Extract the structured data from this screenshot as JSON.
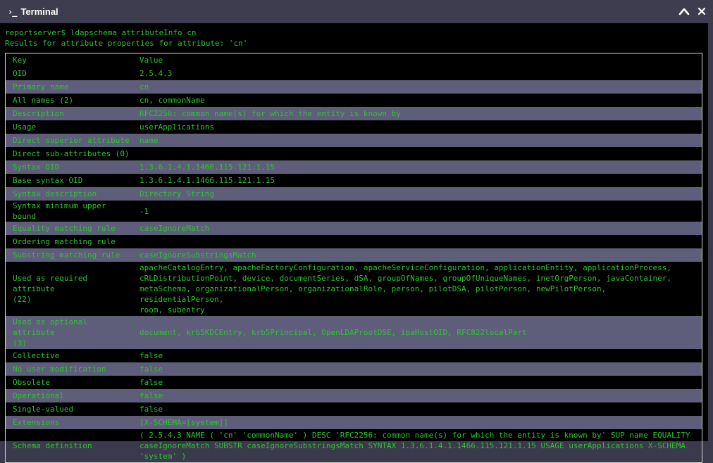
{
  "window": {
    "title": "Terminal",
    "icon": "terminal-icon",
    "prompt_glyph": "›_"
  },
  "terminal": {
    "command_line": "reportserver$ ldapschema attributeInfo cn",
    "result_line": "Results for attribute properties for attribute: 'cn'",
    "table": {
      "header": {
        "key": "Key",
        "value": "Value"
      },
      "rows": [
        {
          "key": "OID",
          "value": "2.5.4.3"
        },
        {
          "key": "Primary name",
          "value": "cn"
        },
        {
          "key": "All names (2)",
          "value": "cn, commonName"
        },
        {
          "key": "Description",
          "value": "RFC2256: common name(s) for which the entity is known by"
        },
        {
          "key": "Usage",
          "value": "userApplications"
        },
        {
          "key": "Direct superior attribute",
          "value": "name"
        },
        {
          "key": "Direct sub-attributes (0)",
          "value": ""
        },
        {
          "key": "Syntax OID",
          "value": "1.3.6.1.4.1.1466.115.121.1.15"
        },
        {
          "key": "Base syntax OID",
          "value": "1.3.6.1.4.1.1466.115.121.1.15"
        },
        {
          "key": "Syntax description",
          "value": "Directory String"
        },
        {
          "key": "Syntax minimum upper bound",
          "value": "-1"
        },
        {
          "key": "Equality matching rule",
          "value": "caseIgnoreMatch"
        },
        {
          "key": "Ordering matching rule",
          "value": ""
        },
        {
          "key": "Substring matching rule",
          "value": "caseIgnoreSubstringsMatch"
        },
        {
          "key": "Used as required attribute\n(22)",
          "value": "apacheCatalogEntry, apacheFactoryConfiguration, apacheServiceConfiguration, applicationEntity, applicationProcess,\ncRLDistributionPoint, device, documentSeries, dSA, groupOfNames, groupOfUniqueNames, inetOrgPerson, javaContainer,\nmetaSchema, organizationalPerson, organizationalRole, person, pilotDSA, pilotPerson, newPilotPerson, residentialPerson,\nroom, subentry"
        },
        {
          "key": "Used as optional attribute\n(3)",
          "value": "document, krb5KDCEntry, krb5Principal, OpenLDAProotDSE, ipaHostOID, RFC822localPart"
        },
        {
          "key": "Collective",
          "value": "false"
        },
        {
          "key": "No user modification",
          "value": "false"
        },
        {
          "key": "Obsolete",
          "value": "false"
        },
        {
          "key": "Operational",
          "value": "false"
        },
        {
          "key": "Single-valued",
          "value": "false"
        },
        {
          "key": "Extensions",
          "value": "[X-SCHEMA=[system]]"
        },
        {
          "key": "Schema definition",
          "value": "( 2.5.4.3 NAME ( 'cn' 'commonName' ) DESC 'RFC2256: common name(s) for which the entity is known by' SUP name EQUALITY\ncaseIgnoreMatch SUBSTR caseIgnoreSubstringsMatch SYNTAX 1.3.6.1.4.1.1466.115.121.1.15 USAGE userApplications X-SCHEMA\n'system' )"
        }
      ]
    }
  },
  "colors": {
    "text_green": "#2ec230",
    "row_alt": "#5e5e7b",
    "titlebar": "#3d3d4f",
    "terminal_bg": "#000000"
  }
}
